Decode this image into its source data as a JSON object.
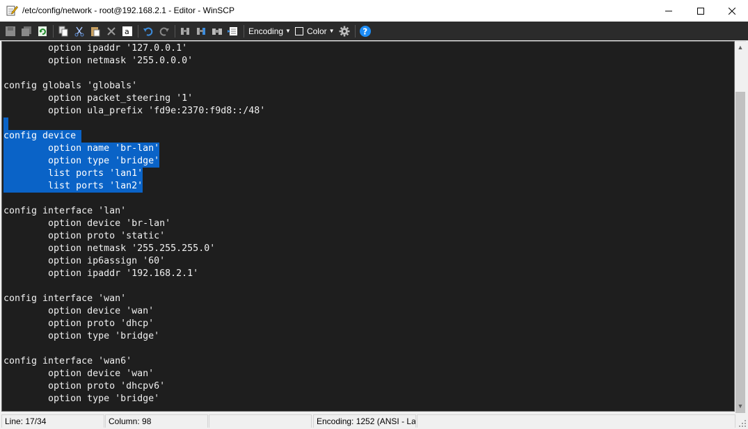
{
  "window": {
    "title": "/etc/config/network - root@192.168.2.1 - Editor - WinSCP",
    "minimize": "—",
    "maximize": "☐",
    "close": "✕"
  },
  "toolbar": {
    "encoding_label": "Encoding",
    "color_label": "Color",
    "icons": [
      "save-icon",
      "save-all-icon",
      "reload-icon",
      "copy-icon",
      "cut-icon",
      "paste-icon",
      "delete-icon",
      "select-all-icon",
      "undo-icon",
      "redo-icon",
      "find-icon",
      "replace-icon",
      "find-next-icon",
      "goto-line-icon",
      "encoding-dropdown",
      "color-checkbox",
      "settings-icon",
      "help-icon"
    ],
    "colors": {
      "background": "#2b2b2b",
      "help": "#1c8cf5"
    }
  },
  "editor": {
    "lines": [
      {
        "text": "        option ipaddr '127.0.0.1'",
        "selected": false
      },
      {
        "text": "        option netmask '255.0.0.0'",
        "selected": false
      },
      {
        "text": "",
        "selected": false
      },
      {
        "text": "config globals 'globals'",
        "selected": false
      },
      {
        "text": "        option packet_steering '1'",
        "selected": false
      },
      {
        "text": "        option ula_prefix 'fd9e:2370:f9d8::/48'",
        "selected": false
      },
      {
        "text": "",
        "selected": true
      },
      {
        "text": "config device ",
        "selected": true
      },
      {
        "text": "        option name 'br-lan'",
        "selected": true
      },
      {
        "text": "        option type 'bridge'",
        "selected": true
      },
      {
        "text": "        list ports 'lan1'",
        "selected": true
      },
      {
        "text": "        list ports 'lan2'",
        "selected": true
      },
      {
        "text": "",
        "selected": false
      },
      {
        "text": "config interface 'lan'",
        "selected": false
      },
      {
        "text": "        option device 'br-lan'",
        "selected": false
      },
      {
        "text": "        option proto 'static'",
        "selected": false
      },
      {
        "text": "        option netmask '255.255.255.0'",
        "selected": false
      },
      {
        "text": "        option ip6assign '60'",
        "selected": false
      },
      {
        "text": "        option ipaddr '192.168.2.1'",
        "selected": false
      },
      {
        "text": "",
        "selected": false
      },
      {
        "text": "config interface 'wan'",
        "selected": false
      },
      {
        "text": "        option device 'wan'",
        "selected": false
      },
      {
        "text": "        option proto 'dhcp'",
        "selected": false
      },
      {
        "text": "        option type 'bridge'",
        "selected": false
      },
      {
        "text": "",
        "selected": false
      },
      {
        "text": "config interface 'wan6'",
        "selected": false
      },
      {
        "text": "        option device 'wan'",
        "selected": false
      },
      {
        "text": "        option proto 'dhcpv6'",
        "selected": false
      },
      {
        "text": "        option type 'bridge'",
        "selected": false
      }
    ],
    "colors": {
      "background": "#1e1e1e",
      "text": "#f0f0f0",
      "selection": "#0a63c7"
    }
  },
  "statusbar": {
    "line": "Line: 17/34",
    "column": "Column: 98",
    "empty": "",
    "encoding": "Encoding: 1252  (ANSI - La"
  }
}
